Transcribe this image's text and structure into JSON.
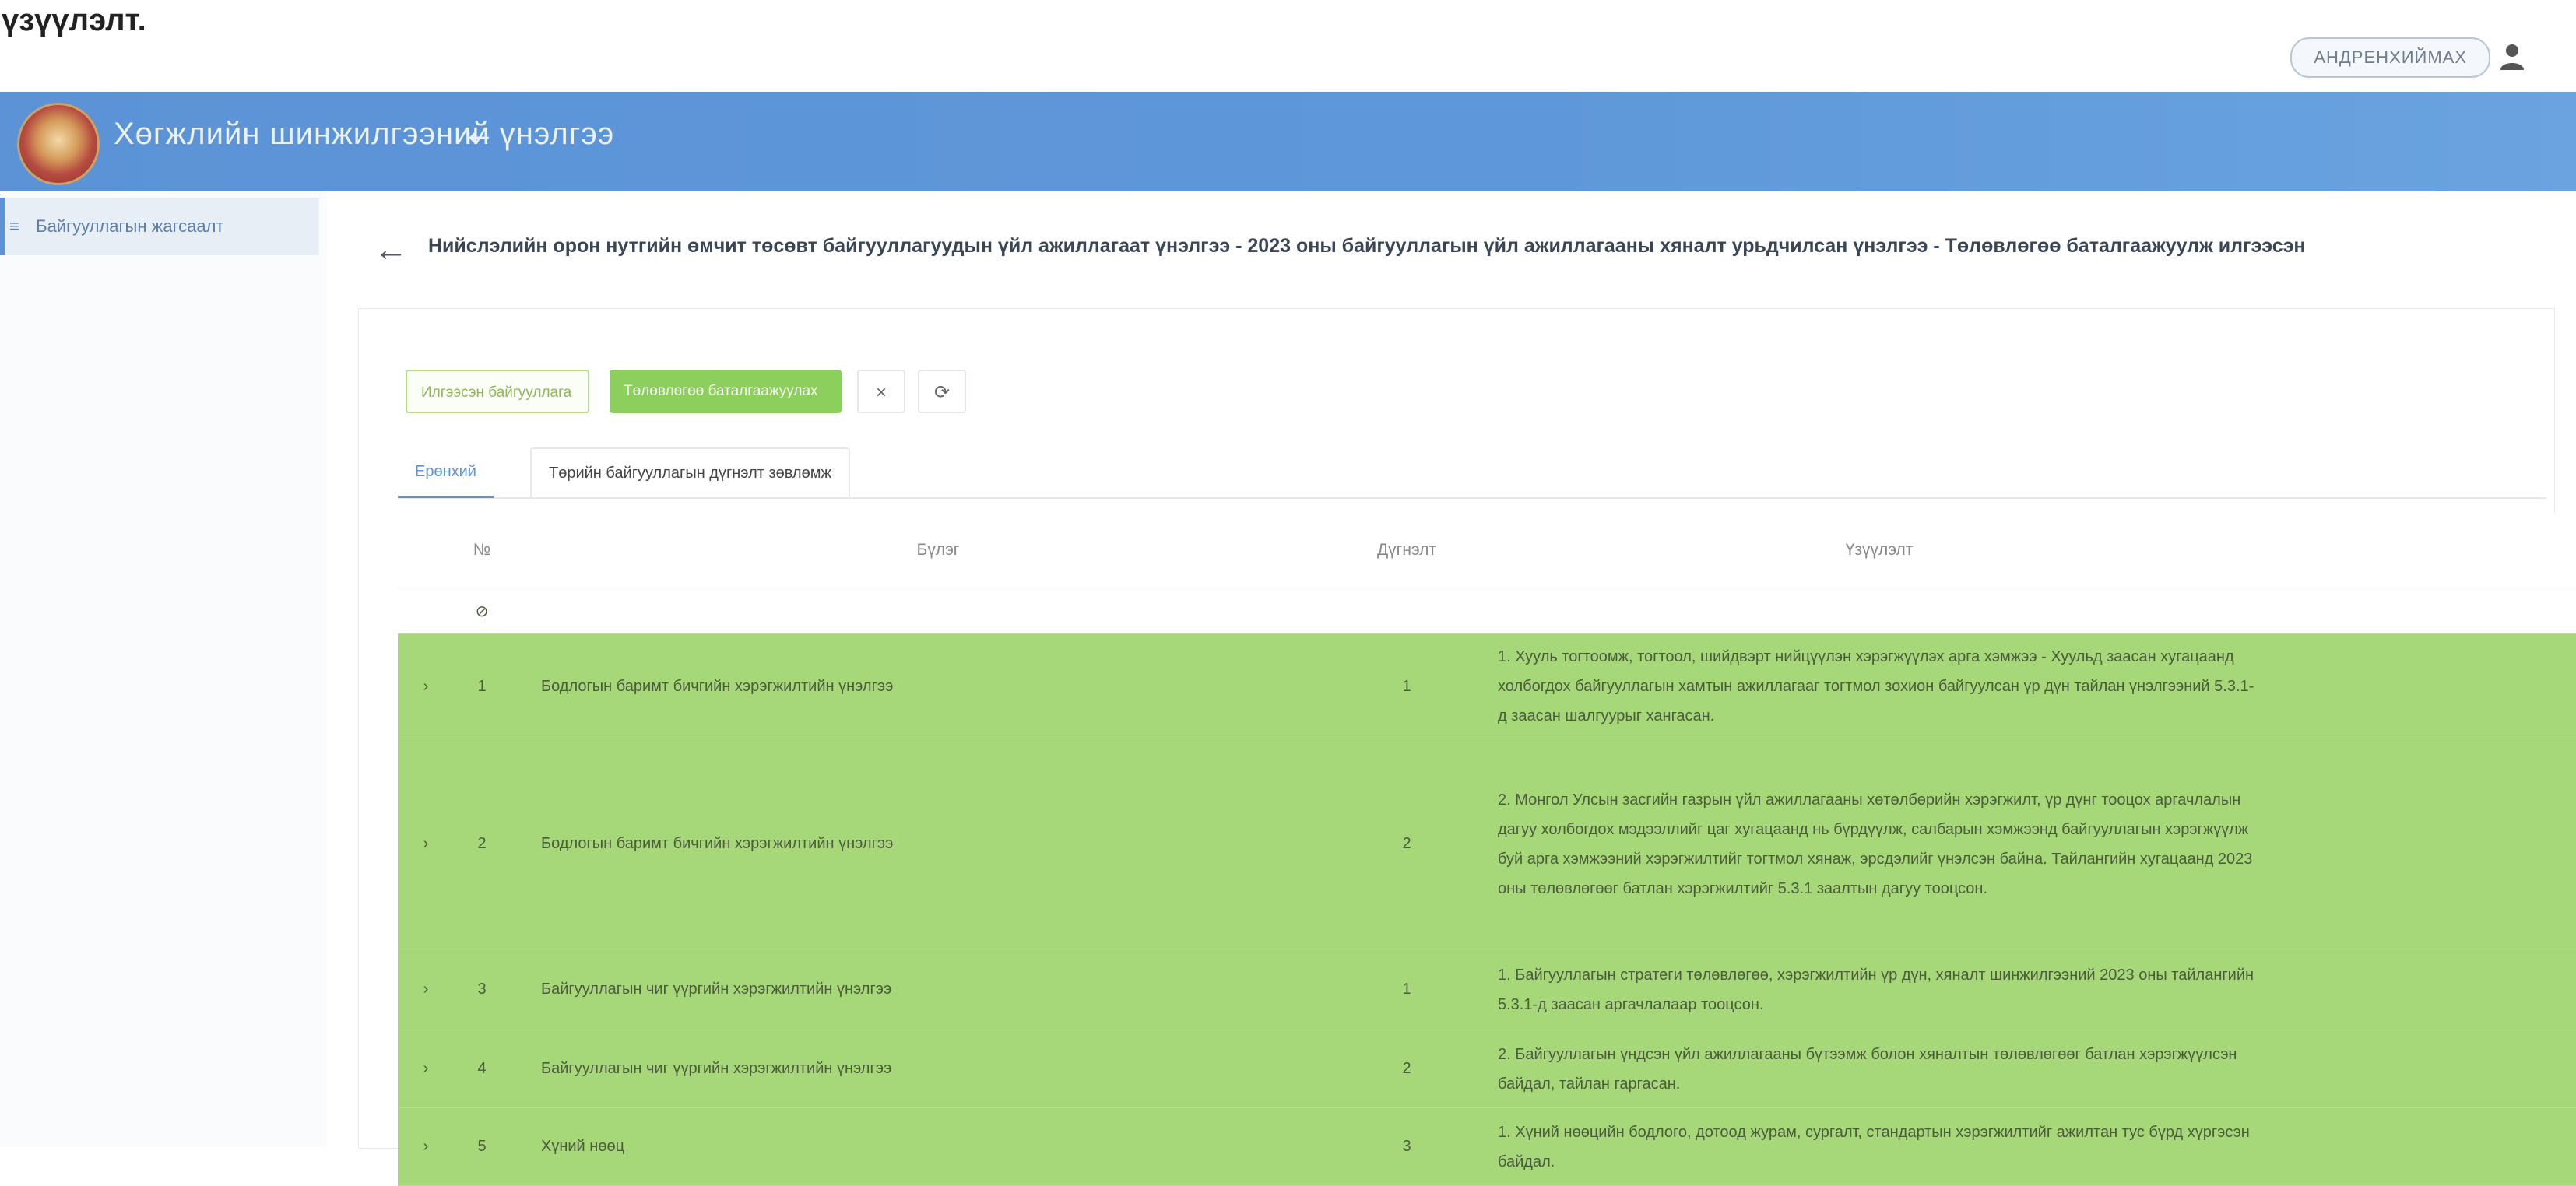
{
  "figure_label": "үзүүлэлт.",
  "user": {
    "name": "АНДРЕНХИЙМАХ"
  },
  "app": {
    "title": "Хөгжлийн шинжилгээний үнэлгээ",
    "collapse_icon": "sidebar-collapse-icon"
  },
  "sidebar": {
    "items": [
      {
        "label": "Байгууллагын жагсаалт",
        "icon": "list-icon"
      }
    ]
  },
  "page": {
    "title": "Нийслэлийн орон нутгийн өмчит төсөвт байгууллагуудын үйл ажиллагаат үнэлгээ - 2023 оны байгууллагын үйл ажиллагааны хяналт урьдчилсан үнэлгээ - Төлөвлөгөө баталгаажуулж илгээсэн"
  },
  "toolbar": {
    "btn1": "Илгээсэн байгууллага",
    "btn2": "Төлөвлөгөө баталгаажуулах",
    "close": "×",
    "refresh": "⟳"
  },
  "tabs": [
    {
      "label": "Ерөнхий"
    },
    {
      "label": "Төрийн байгууллагын дүгнэлт зөвлөмж"
    }
  ],
  "table": {
    "headers": {
      "num": "№",
      "name": "Бүлэг",
      "value": "Дүгнэлт",
      "result": "Үзүүлэлт"
    },
    "filter_symbol": "⊘",
    "rows": [
      {
        "num": "1",
        "name": "Бодлогын баримт бичгийн хэрэгжилтийн үнэлгээ",
        "value": "1",
        "result": "1. Хууль тогтоомж, тогтоол, шийдвэрт нийцүүлэн хэрэгжүүлэх арга хэмжээ - Хуульд заасан хугацаанд холбогдох байгууллагын хамтын ажиллагааг тогтмол зохион байгуулсан үр дүн тайлан үнэлгээний 5.3.1-д заасан шалгуурыг хангасан."
      },
      {
        "num": "2",
        "name": "Бодлогын баримт бичгийн хэрэгжилтийн үнэлгээ",
        "value": "2",
        "result": "2. Монгол Улсын засгийн газрын үйл ажиллагааны хөтөлбөрийн хэрэгжилт, үр дүнг тооцох аргачлалын дагуу холбогдох мэдээллийг цаг хугацаанд нь бүрдүүлж, салбарын хэмжээнд байгууллагын хэрэгжүүлж буй арга хэмжээний хэрэгжилтийг тогтмол хянаж, эрсдэлийг үнэлсэн байна. Тайлангийн хугацаанд 2023 оны төлөвлөгөөг батлан хэрэгжилтийг 5.3.1 заалтын дагуу тооцсон."
      },
      {
        "num": "3",
        "name": "Байгууллагын чиг үүргийн хэрэгжилтийн үнэлгээ",
        "value": "1",
        "result": "1. Байгууллагын стратеги төлөвлөгөө, хэрэгжилтийн үр дүн, хяналт шинжилгээний 2023 оны тайлангийн 5.3.1-д заасан аргачлалаар тооцсон."
      },
      {
        "num": "4",
        "name": "Байгууллагын чиг үүргийн хэрэгжилтийн үнэлгээ",
        "value": "2",
        "result": "2. Байгууллагын үндсэн үйл ажиллагааны бүтээмж болон хяналтын төлөвлөгөөг батлан хэрэгжүүлсэн байдал, тайлан гаргасан."
      },
      {
        "num": "5",
        "name": "Хүний нөөц",
        "value": "3",
        "result": "1. Хүний нөөцийн бодлого, дотоод журам, сургалт, стандартын хэрэгжилтийг ажилтан тус бүрд хүргэсэн байдал."
      }
    ]
  }
}
